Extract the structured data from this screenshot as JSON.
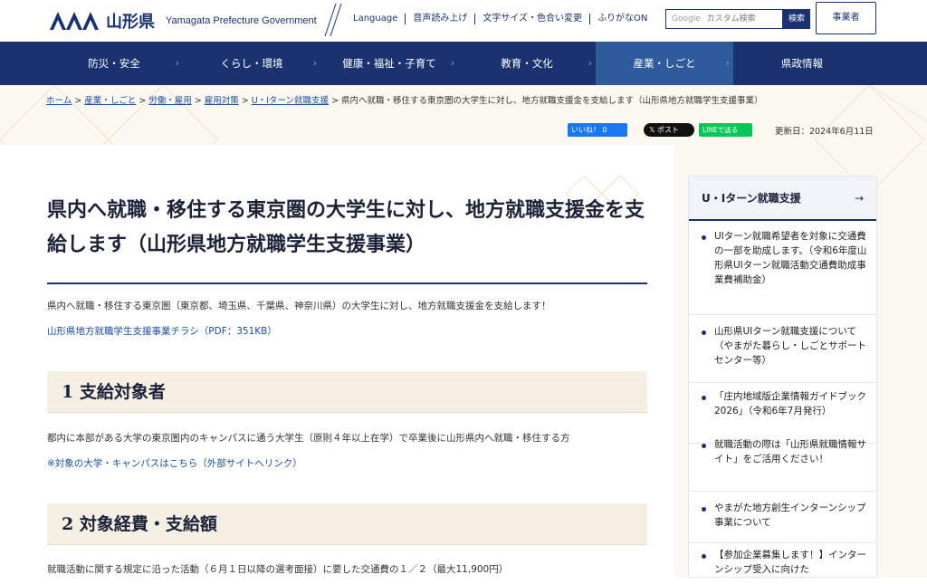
{
  "header": {
    "logo_jp": "山形県",
    "logo_en": "Yamagata Prefecture Government",
    "util_links": [
      "Language",
      "音声読み上げ",
      "文字サイズ・色合い変更",
      "ふりがなON"
    ],
    "search_placeholder": "カスタム検索",
    "search_google": "Google",
    "search_button": "検索",
    "business_button": "事業者"
  },
  "nav": {
    "items": [
      "防災・安全",
      "くらし・環境",
      "健康・福祉・子育て",
      "教育・文化",
      "産業・しごと",
      "県政情報"
    ],
    "active_index": 4
  },
  "breadcrumb": {
    "links": [
      "ホーム",
      "産業・しごと",
      "労働・雇用",
      "雇用対策",
      "U・Iターン就職支援"
    ],
    "current": "県内へ就職・移住する東京圏の大学生に対し、地方就職支援金を支給します（山形県地方就職学生支援事業）"
  },
  "social": {
    "facebook": "いいね！ 0",
    "x": "ポスト",
    "line": "LINEで送る"
  },
  "updated": "更新日：2024年6月11日",
  "main": {
    "title": "県内へ就職・移住する東京圏の大学生に対し、地方就職支援金を支給します（山形県地方就職学生支援事業）",
    "intro": "県内へ就職・移住する東京圏（東京都、埼玉県、千葉県、神奈川県）の大学生に対し、地方就職支援金を支給します！",
    "flyer_link": "山形県地方就職学生支援事業チラシ（PDF：351KB）",
    "section1_title": "1 支給対象者",
    "section1_text": "都内に本部がある大学の東京圏内のキャンパスに通う大学生（原則４年以上在学）で卒業後に山形県内へ就職・移住する方",
    "section1_link": "※対象の大学・キャンパスはこちら（外部サイトへリンク）",
    "section2_title": "2 対象経費・支給額",
    "section2_text": "就職活動に関する規定に沿った活動（６月１日以降の選考面接）に要した交通費の１／２（最大11,900円）"
  },
  "sidebar": {
    "title": "U・Iターン就職支援",
    "items": [
      "UIターン就職希望者を対象に交通費の一部を助成します。（令和6年度山形県UIターン就職活動交通費助成事業費補助金）",
      "山形県UIターン就職支援について（やまがた暮らし・しごとサポートセンター等）",
      "「庄内地域版企業情報ガイドブック2026」（令和6年7月発行）",
      "就職活動の際は「山形県就職情報サイト」をご活用ください！",
      "やまがた地方創生インターンシップ事業について",
      "【参加企業募集します！】インターンシップ受入に向けた"
    ]
  },
  "colors": {
    "navy": "#1a3270",
    "nav_active": "#2f5a9b",
    "link": "#1a4e9a",
    "heading_bg": "#f6f0e4"
  }
}
